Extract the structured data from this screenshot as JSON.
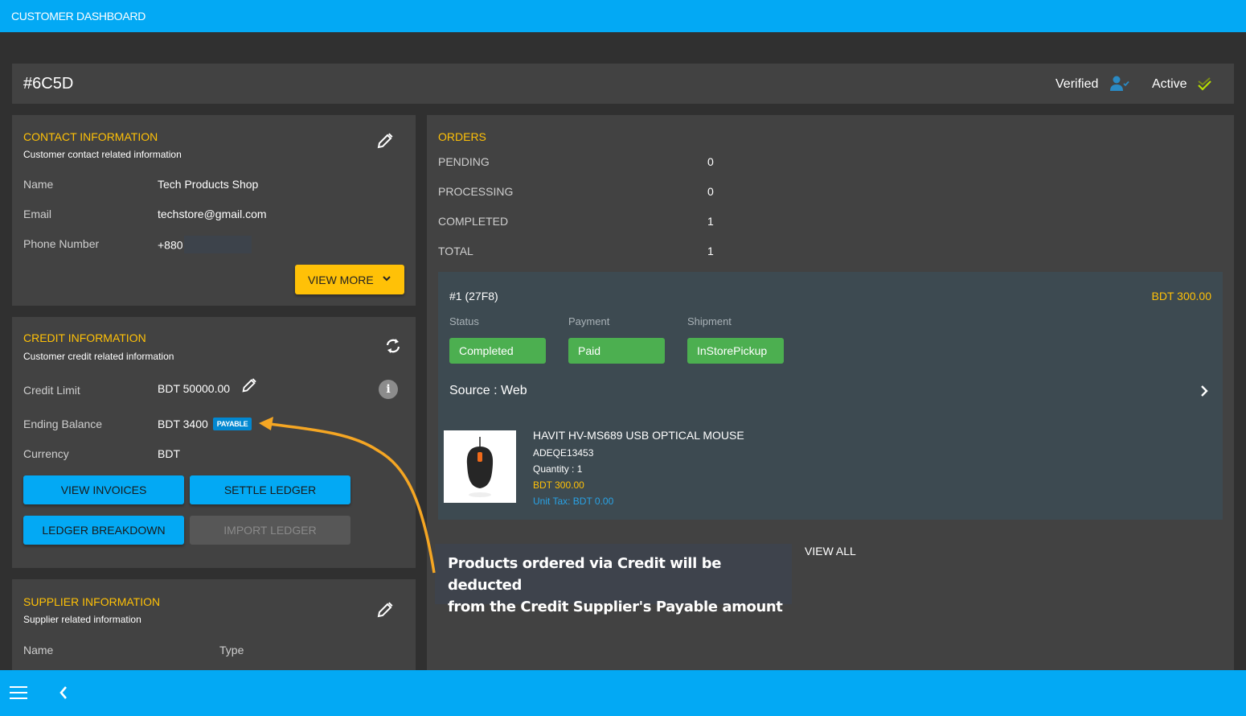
{
  "app": {
    "title": "CUSTOMER DASHBOARD"
  },
  "customer": {
    "id": "#6C5D",
    "verified_label": "Verified",
    "active_label": "Active"
  },
  "contact": {
    "title": "CONTACT INFORMATION",
    "subtitle": "Customer contact related information",
    "fields": [
      {
        "label": "Name",
        "value": "Tech Products Shop"
      },
      {
        "label": "Email",
        "value": "techstore@gmail.com"
      },
      {
        "label": "Phone Number",
        "value": "+880"
      }
    ],
    "view_more_label": "VIEW MORE"
  },
  "credit": {
    "title": "CREDIT INFORMATION",
    "subtitle": "Customer credit related information",
    "fields": [
      {
        "label": "Credit Limit",
        "value": "BDT 50000.00"
      },
      {
        "label": "Ending Balance",
        "value": "BDT 3400",
        "badge": "PAYABLE"
      },
      {
        "label": "Currency",
        "value": "BDT"
      }
    ],
    "buttons": {
      "view_invoices": "VIEW INVOICES",
      "settle_ledger": "SETTLE LEDGER",
      "ledger_breakdown": "LEDGER BREAKDOWN",
      "import_ledger": "IMPORT LEDGER"
    }
  },
  "supplier": {
    "title": "SUPPLIER INFORMATION",
    "subtitle": "Supplier related information",
    "columns": [
      "Name",
      "Type"
    ]
  },
  "orders": {
    "title": "ORDERS",
    "stats": [
      {
        "label": "PENDING",
        "value": "0"
      },
      {
        "label": "PROCESSING",
        "value": "0"
      },
      {
        "label": "COMPLETED",
        "value": "1"
      },
      {
        "label": "TOTAL",
        "value": "1"
      }
    ],
    "order": {
      "id": "#1 (27F8)",
      "total": "BDT 300.00",
      "status_label": "Status",
      "status": "Completed",
      "payment_label": "Payment",
      "payment": "Paid",
      "shipment_label": "Shipment",
      "shipment": "InStorePickup",
      "source": "Source : Web",
      "item": {
        "name": "HAVIT HV-MS689 USB OPTICAL MOUSE",
        "sku": "ADEQE13453",
        "quantity": "Quantity : 1",
        "price": "BDT 300.00",
        "unit_tax": "Unit Tax: BDT 0.00"
      }
    },
    "view_all_label": "VIEW ALL"
  },
  "annotation": {
    "text_line1": "Products ordered via Credit will be deducted",
    "text_line2": "from the Credit Supplier's Payable amount",
    "arrow_color": "#f5a623"
  },
  "colors": {
    "primary": "#03a9f4",
    "accent": "#ffc107",
    "success": "#4caf50",
    "badge": "#0288d1"
  }
}
